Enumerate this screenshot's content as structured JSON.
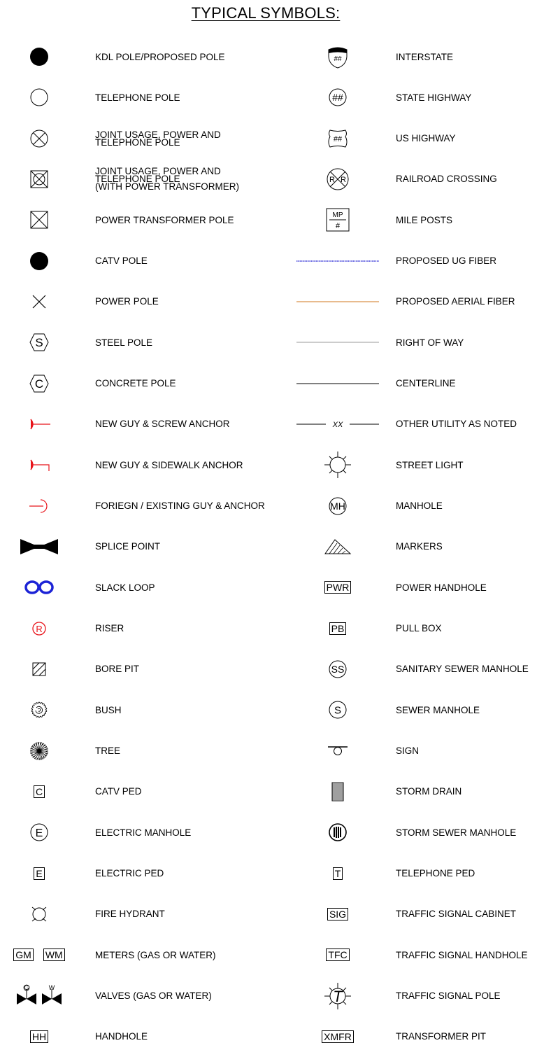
{
  "title": "TYPICAL SYMBOLS:",
  "colors": {
    "red": "#e8141b",
    "blue": "#1c23d6",
    "fiber_blue": "#3a3ad8",
    "aerial_orange": "#d9924a",
    "row_line": "#aaaaaa"
  },
  "left": [
    {
      "icon": "filled-circle-icon",
      "lines": [
        "KDL POLE/PROPOSED POLE"
      ]
    },
    {
      "icon": "open-circle-icon",
      "lines": [
        "TELEPHONE POLE"
      ]
    },
    {
      "icon": "circle-x-icon",
      "lines": [
        "JOINT USAGE, POWER AND",
        "TELEPHONE POLE"
      ]
    },
    {
      "icon": "square-x-circle-icon",
      "lines": [
        "JOINT USAGE, POWER AND",
        "TELEPHONE POLE",
        "(WITH POWER TRANSFORMER)"
      ]
    },
    {
      "icon": "square-x-icon",
      "lines": [
        "POWER TRANSFORMER POLE"
      ]
    },
    {
      "icon": "filled-circle-icon",
      "lines": [
        "CATV POLE"
      ]
    },
    {
      "icon": "x-mark-icon",
      "lines": [
        "POWER POLE"
      ]
    },
    {
      "icon": "hexagon-letter-icon",
      "letter": "S",
      "lines": [
        "STEEL POLE"
      ]
    },
    {
      "icon": "hexagon-letter-icon",
      "letter": "C",
      "lines": [
        "CONCRETE POLE"
      ]
    },
    {
      "icon": "guy-screw-anchor-icon",
      "lines": [
        "NEW GUY & SCREW ANCHOR"
      ]
    },
    {
      "icon": "guy-sidewalk-anchor-icon",
      "lines": [
        "NEW GUY & SIDEWALK ANCHOR"
      ]
    },
    {
      "icon": "existing-guy-anchor-icon",
      "lines": [
        "FORIEGN / EXISTING GUY & ANCHOR"
      ]
    },
    {
      "icon": "splice-point-icon",
      "lines": [
        "SPLICE POINT"
      ]
    },
    {
      "icon": "slack-loop-icon",
      "lines": [
        "SLACK LOOP"
      ]
    },
    {
      "icon": "riser-icon",
      "letter": "R",
      "lines": [
        "RISER"
      ]
    },
    {
      "icon": "bore-pit-icon",
      "lines": [
        "BORE PIT"
      ]
    },
    {
      "icon": "bush-icon",
      "lines": [
        "BUSH"
      ]
    },
    {
      "icon": "tree-icon",
      "lines": [
        "TREE"
      ]
    },
    {
      "icon": "boxed-text-icon",
      "boxes": [
        "C"
      ],
      "lines": [
        "CATV PED"
      ]
    },
    {
      "icon": "circled-letter-icon",
      "letter": "E",
      "lines": [
        "ELECTRIC MANHOLE"
      ]
    },
    {
      "icon": "boxed-text-icon",
      "boxes": [
        "E"
      ],
      "lines": [
        "ELECTRIC PED"
      ]
    },
    {
      "icon": "fire-hydrant-icon",
      "lines": [
        "FIRE HYDRANT"
      ]
    },
    {
      "icon": "boxed-text-icon",
      "boxes": [
        "GM",
        "WM"
      ],
      "lines": [
        "METERS (GAS OR WATER)"
      ]
    },
    {
      "icon": "valves-icon",
      "marks": [
        "G",
        "W"
      ],
      "lines": [
        "VALVES (GAS OR WATER)"
      ]
    },
    {
      "icon": "boxed-text-icon",
      "boxes": [
        "HH"
      ],
      "lines": [
        "HANDHOLE"
      ]
    }
  ],
  "right": [
    {
      "icon": "interstate-shield-icon",
      "text": "##",
      "lines": [
        "INTERSTATE"
      ]
    },
    {
      "icon": "circled-text-icon",
      "text": "##",
      "lines": [
        "STATE HIGHWAY"
      ]
    },
    {
      "icon": "us-highway-shield-icon",
      "text": "##",
      "lines": [
        "US HIGHWAY"
      ]
    },
    {
      "icon": "railroad-crossing-icon",
      "text": "R",
      "lines": [
        "RAILROAD CROSSING"
      ]
    },
    {
      "icon": "mile-post-icon",
      "top": "MP",
      "bottom": "#",
      "lines": [
        "MILE POSTS"
      ]
    },
    {
      "icon": "ug-fiber-line-icon",
      "lines": [
        "PROPOSED UG FIBER"
      ]
    },
    {
      "icon": "aerial-fiber-line-icon",
      "lines": [
        "PROPOSED AERIAL FIBER"
      ]
    },
    {
      "icon": "right-of-way-line-icon",
      "lines": [
        "RIGHT OF WAY"
      ]
    },
    {
      "icon": "centerline-icon",
      "lines": [
        "CENTERLINE"
      ]
    },
    {
      "icon": "other-utility-line-icon",
      "text": "XX",
      "lines": [
        "OTHER UTILITY AS NOTED"
      ]
    },
    {
      "icon": "street-light-icon",
      "lines": [
        "STREET LIGHT"
      ]
    },
    {
      "icon": "circled-text-icon",
      "text": "MH",
      "lines": [
        "MANHOLE"
      ]
    },
    {
      "icon": "marker-triangle-icon",
      "lines": [
        "MARKERS"
      ]
    },
    {
      "icon": "boxed-text-icon",
      "boxes": [
        "PWR"
      ],
      "lines": [
        "POWER HANDHOLE"
      ]
    },
    {
      "icon": "boxed-text-icon",
      "boxes": [
        "PB"
      ],
      "lines": [
        "PULL BOX"
      ]
    },
    {
      "icon": "circled-text-icon",
      "text": "SS",
      "lines": [
        "SANITARY SEWER MANHOLE"
      ]
    },
    {
      "icon": "circled-text-icon",
      "text": "S",
      "lines": [
        "SEWER MANHOLE"
      ]
    },
    {
      "icon": "sign-icon",
      "lines": [
        "SIGN"
      ]
    },
    {
      "icon": "storm-drain-icon",
      "lines": [
        "STORM DRAIN"
      ]
    },
    {
      "icon": "storm-sewer-manhole-icon",
      "lines": [
        "STORM SEWER MANHOLE"
      ]
    },
    {
      "icon": "boxed-text-icon",
      "boxes": [
        "T"
      ],
      "lines": [
        "TELEPHONE PED"
      ]
    },
    {
      "icon": "boxed-text-icon",
      "boxes": [
        "SIG"
      ],
      "lines": [
        "TRAFFIC SIGNAL CABINET"
      ]
    },
    {
      "icon": "boxed-text-icon",
      "boxes": [
        "TFC"
      ],
      "lines": [
        "TRAFFIC SIGNAL HANDHOLE"
      ]
    },
    {
      "icon": "traffic-signal-pole-icon",
      "text": "T",
      "lines": [
        "TRAFFIC SIGNAL POLE"
      ]
    },
    {
      "icon": "boxed-text-icon",
      "boxes": [
        "XMFR"
      ],
      "lines": [
        "TRANSFORMER PIT"
      ]
    }
  ]
}
